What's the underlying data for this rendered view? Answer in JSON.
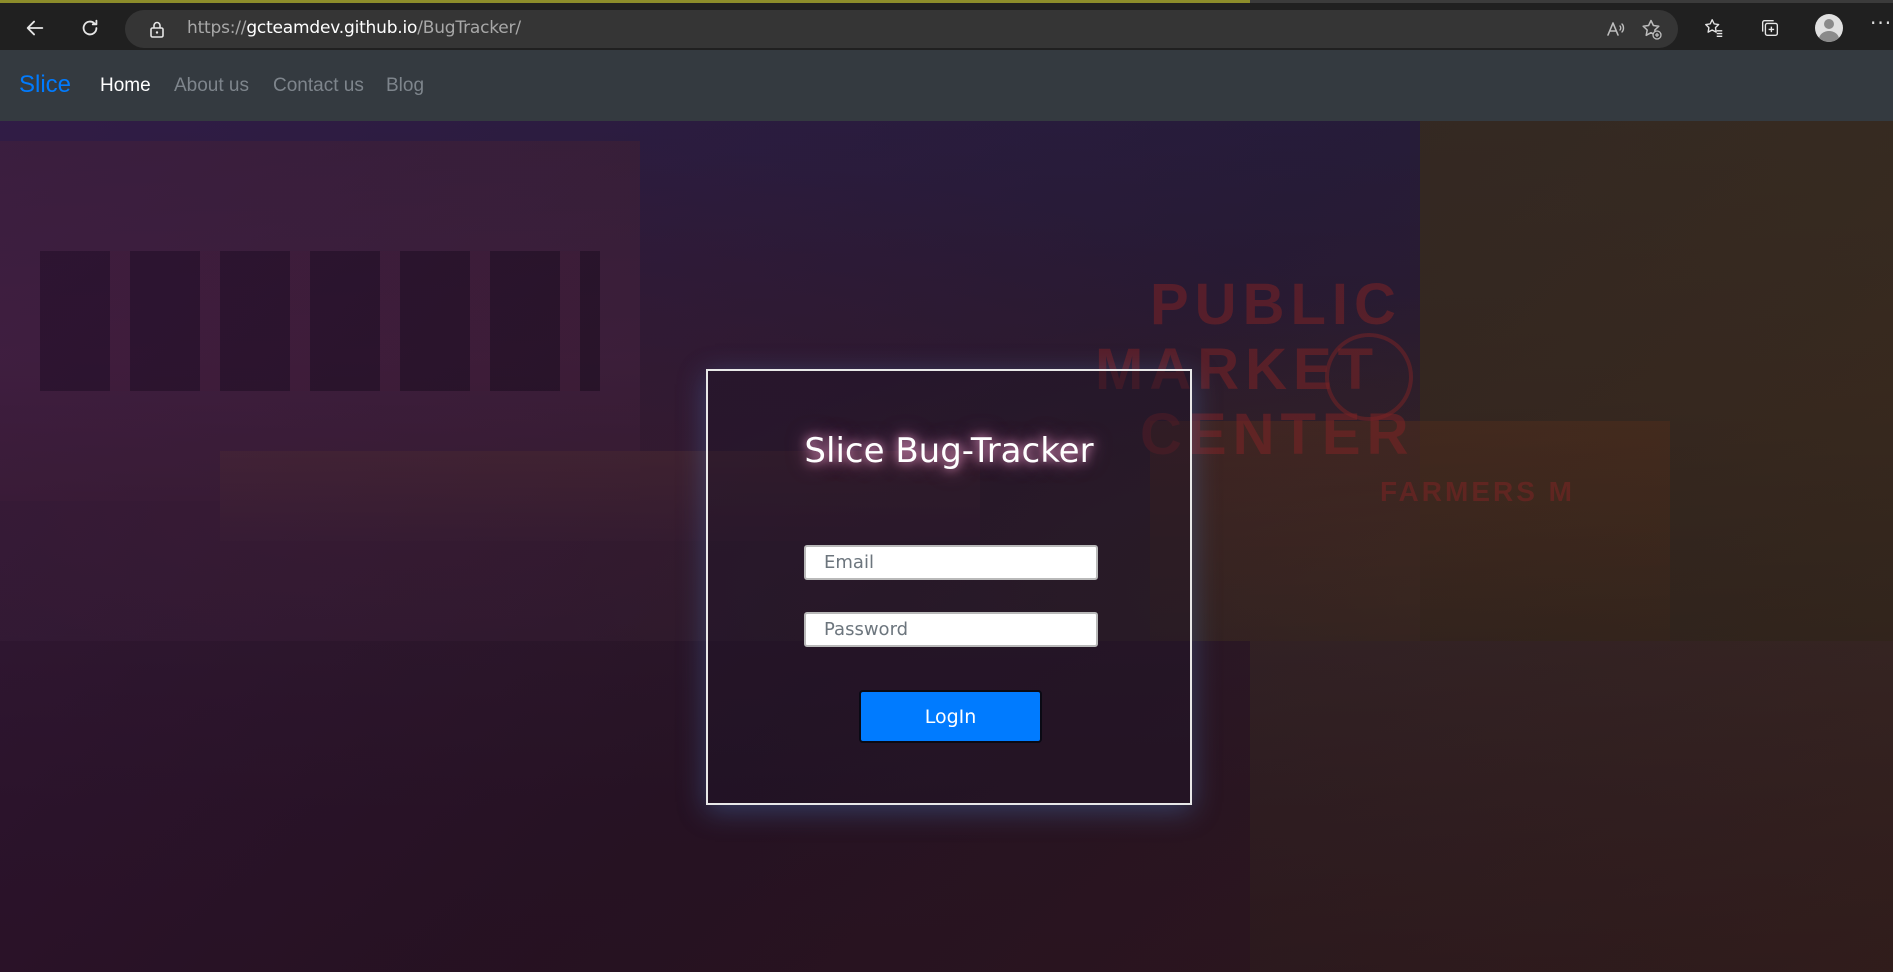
{
  "browser": {
    "url_prefix": "https://",
    "url_host": "gcteamdev.github.io",
    "url_path": "/BugTracker/",
    "icons": [
      "back-icon",
      "refresh-icon",
      "lock-icon",
      "read-aloud-icon",
      "add-favorite-icon",
      "favorites-icon",
      "collections-icon",
      "profile-icon",
      "more-icon"
    ],
    "more_label": "···"
  },
  "navbar": {
    "brand": "Slice",
    "links": [
      {
        "label": "Home",
        "active": true
      },
      {
        "label": "About us",
        "active": false
      },
      {
        "label": "Contact us",
        "active": false
      },
      {
        "label": "Blog",
        "active": false
      }
    ]
  },
  "login": {
    "title": "Slice Bug-Tracker",
    "email_placeholder": "Email",
    "password_placeholder": "Password",
    "button_label": "LogIn"
  },
  "colors": {
    "navbar_bg": "#343a40",
    "brand": "#007bff",
    "button": "#007bff"
  }
}
